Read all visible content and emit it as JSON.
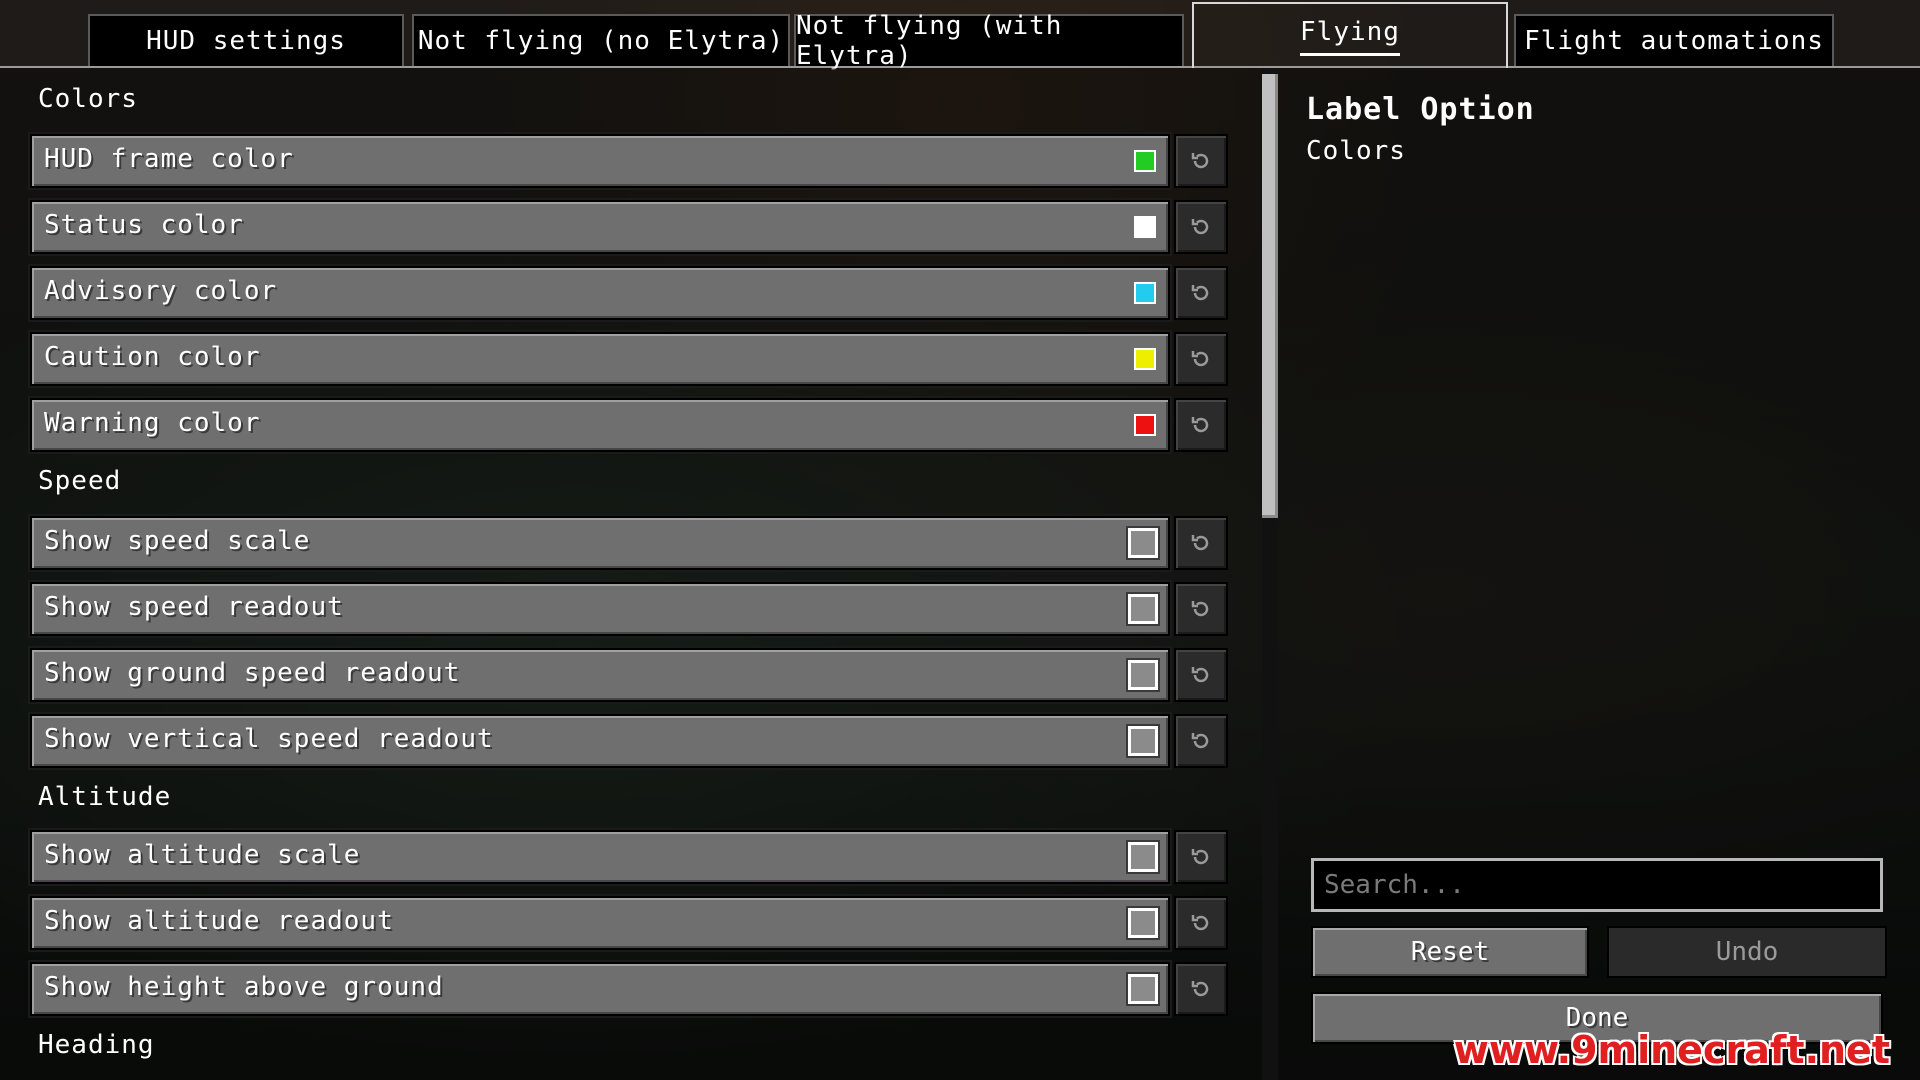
{
  "tabs": [
    {
      "label": "HUD settings"
    },
    {
      "label": "Not flying (no Elytra)"
    },
    {
      "label": "Not flying (with Elytra)"
    },
    {
      "label": "Flying"
    },
    {
      "label": "Flight automations"
    }
  ],
  "sections": {
    "colors": "Colors",
    "speed": "Speed",
    "altitude": "Altitude",
    "heading": "Heading"
  },
  "color_options": [
    {
      "label": "HUD frame color",
      "color": "#22cc22"
    },
    {
      "label": "Status color",
      "color": "#ffffff"
    },
    {
      "label": "Advisory color",
      "color": "#22ccee"
    },
    {
      "label": "Caution color",
      "color": "#eeee00"
    },
    {
      "label": "Warning color",
      "color": "#ee1111"
    }
  ],
  "speed_options": [
    {
      "label": "Show speed scale",
      "checked": false
    },
    {
      "label": "Show speed readout",
      "checked": false
    },
    {
      "label": "Show ground speed readout",
      "checked": false
    },
    {
      "label": "Show vertical speed readout",
      "checked": false
    }
  ],
  "altitude_options": [
    {
      "label": "Show altitude scale",
      "checked": false
    },
    {
      "label": "Show altitude readout",
      "checked": false
    },
    {
      "label": "Show height above ground",
      "checked": false
    }
  ],
  "description": {
    "title": "Label Option",
    "subtitle": "Colors"
  },
  "search": {
    "placeholder": "Search..."
  },
  "buttons": {
    "reset": "Reset",
    "undo": "Undo",
    "done": "Done"
  },
  "watermark": "www.9minecraft.net",
  "reset_icon": "reset-arrow-icon"
}
